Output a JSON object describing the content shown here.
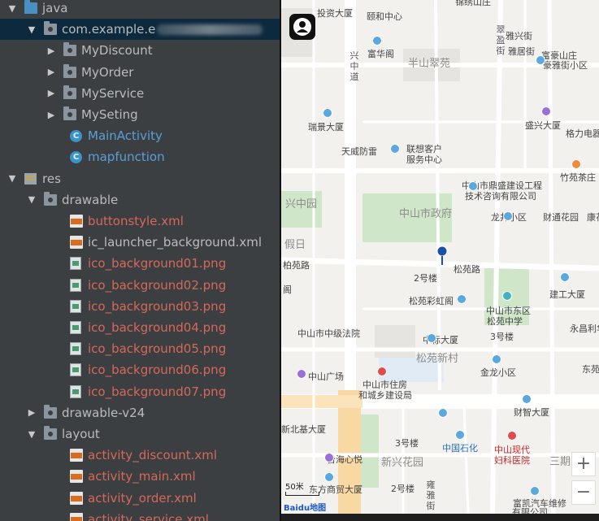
{
  "tree": {
    "items": [
      {
        "label": "java",
        "arrow": "▼",
        "icon": "folder-java",
        "indent": 0,
        "style": "plain"
      },
      {
        "label": "com.example.e",
        "arrow": "▼",
        "icon": "folder-package",
        "indent": 1,
        "style": "plain",
        "selected": true,
        "blurred_suffix": true
      },
      {
        "label": "MyDiscount",
        "arrow": "▶",
        "icon": "folder-package",
        "indent": 2,
        "style": "plain"
      },
      {
        "label": "MyOrder",
        "arrow": "▶",
        "icon": "folder-package",
        "indent": 2,
        "style": "plain"
      },
      {
        "label": "MyService",
        "arrow": "▶",
        "icon": "folder-package",
        "indent": 2,
        "style": "plain"
      },
      {
        "label": "MySeting",
        "arrow": "▶",
        "icon": "folder-package",
        "indent": 2,
        "style": "plain"
      },
      {
        "label": "MainActivity",
        "arrow": "",
        "icon": "class",
        "indent": 3,
        "style": "blue"
      },
      {
        "label": "mapfunction",
        "arrow": "",
        "icon": "class",
        "indent": 3,
        "style": "blue"
      },
      {
        "label": "res",
        "arrow": "▼",
        "icon": "res",
        "indent": 0,
        "style": "plain"
      },
      {
        "label": "drawable",
        "arrow": "▼",
        "icon": "folder-package",
        "indent": 1,
        "style": "plain"
      },
      {
        "label": "buttonstyle.xml",
        "arrow": "",
        "icon": "xml",
        "indent": 3,
        "style": "red"
      },
      {
        "label": "ic_launcher_background.xml",
        "arrow": "",
        "icon": "xml",
        "indent": 3,
        "style": "plain"
      },
      {
        "label": "ico_background01.png",
        "arrow": "",
        "icon": "png",
        "indent": 3,
        "style": "red"
      },
      {
        "label": "ico_background02.png",
        "arrow": "",
        "icon": "png",
        "indent": 3,
        "style": "red"
      },
      {
        "label": "ico_background03.png",
        "arrow": "",
        "icon": "png",
        "indent": 3,
        "style": "red"
      },
      {
        "label": "ico_background04.png",
        "arrow": "",
        "icon": "png",
        "indent": 3,
        "style": "red"
      },
      {
        "label": "ico_background05.png",
        "arrow": "",
        "icon": "png",
        "indent": 3,
        "style": "red"
      },
      {
        "label": "ico_background06.png",
        "arrow": "",
        "icon": "png",
        "indent": 3,
        "style": "red"
      },
      {
        "label": "ico_background07.png",
        "arrow": "",
        "icon": "png",
        "indent": 3,
        "style": "red"
      },
      {
        "label": "drawable-v24",
        "arrow": "▶",
        "icon": "folder-package",
        "indent": 1,
        "style": "plain"
      },
      {
        "label": "layout",
        "arrow": "▼",
        "icon": "folder-package",
        "indent": 1,
        "style": "plain"
      },
      {
        "label": "activity_discount.xml",
        "arrow": "",
        "icon": "xml",
        "indent": 3,
        "style": "red"
      },
      {
        "label": "activity_main.xml",
        "arrow": "",
        "icon": "xml",
        "indent": 3,
        "style": "red"
      },
      {
        "label": "activity_order.xml",
        "arrow": "",
        "icon": "xml",
        "indent": 3,
        "style": "red"
      },
      {
        "label": "activity_service.xml",
        "arrow": "",
        "icon": "xml",
        "indent": 3,
        "style": "red"
      }
    ]
  },
  "map": {
    "zoom_in": "+",
    "zoom_out": "−",
    "scale": "50米",
    "logo": "Baidu地图",
    "labels": [
      {
        "text": "投资大厦",
        "cls": ""
      },
      {
        "text": "颐和中心",
        "cls": ""
      },
      {
        "text": "锦绣山庄",
        "cls": ""
      },
      {
        "text": "雅兴街",
        "cls": ""
      },
      {
        "text": "富华阁",
        "cls": ""
      },
      {
        "text": "半山翠苑",
        "cls": "big"
      },
      {
        "text": "雅居街",
        "cls": ""
      },
      {
        "text": "富豪山庄",
        "cls": ""
      },
      {
        "text": "豪雅街小区",
        "cls": ""
      },
      {
        "text": "瑞景大厦",
        "cls": ""
      },
      {
        "text": "盛兴大厦",
        "cls": ""
      },
      {
        "text": "格力电器",
        "cls": ""
      },
      {
        "text": "天威防雷",
        "cls": ""
      },
      {
        "text": "联想客户",
        "cls": ""
      },
      {
        "text": "服务中心",
        "cls": ""
      },
      {
        "text": "竹苑茶庄",
        "cls": ""
      },
      {
        "text": "中山市鼎盛建设工程",
        "cls": ""
      },
      {
        "text": "技术咨询有限公司",
        "cls": ""
      },
      {
        "text": "兴中园",
        "cls": "big"
      },
      {
        "text": "中山市政府",
        "cls": "big"
      },
      {
        "text": "龙井小区",
        "cls": ""
      },
      {
        "text": "财通花园",
        "cls": ""
      },
      {
        "text": "康花园",
        "cls": ""
      },
      {
        "text": "假日",
        "cls": "big"
      },
      {
        "text": "松苑路",
        "cls": ""
      },
      {
        "text": "柏苑路",
        "cls": ""
      },
      {
        "text": "2号楼",
        "cls": ""
      },
      {
        "text": "建工大厦",
        "cls": ""
      },
      {
        "text": "松苑彩虹阁",
        "cls": ""
      },
      {
        "text": "阁",
        "cls": ""
      },
      {
        "text": "中山市东区",
        "cls": ""
      },
      {
        "text": "松苑中学",
        "cls": ""
      },
      {
        "text": "中山市中级法院",
        "cls": ""
      },
      {
        "text": "中标大厦",
        "cls": ""
      },
      {
        "text": "3号楼",
        "cls": ""
      },
      {
        "text": "永昌利华",
        "cls": ""
      },
      {
        "text": "松苑新村",
        "cls": "big"
      },
      {
        "text": "中山广场",
        "cls": ""
      },
      {
        "text": "中山市住房",
        "cls": ""
      },
      {
        "text": "和城乡建设局",
        "cls": ""
      },
      {
        "text": "金龙小区",
        "cls": ""
      },
      {
        "text": "东苑路",
        "cls": ""
      },
      {
        "text": "财智大厦",
        "cls": ""
      },
      {
        "text": "新北基大厦",
        "cls": ""
      },
      {
        "text": "3号楼",
        "cls": ""
      },
      {
        "text": "中国石化",
        "cls": "blue"
      },
      {
        "text": "中山现代",
        "cls": "red"
      },
      {
        "text": "妇科医院",
        "cls": "red"
      },
      {
        "text": "三期",
        "cls": "big"
      },
      {
        "text": "台海心悦",
        "cls": ""
      },
      {
        "text": "新兴花园",
        "cls": "big"
      },
      {
        "text": "东方商贸大厦",
        "cls": ""
      },
      {
        "text": "2号楼",
        "cls": ""
      },
      {
        "text": "富凯汽车维修",
        "cls": ""
      },
      {
        "text": "有限公司",
        "cls": ""
      },
      {
        "text": "兴中道",
        "cls": "vertical"
      },
      {
        "text": "雍雅街",
        "cls": "vertical"
      },
      {
        "text": "翠盈街",
        "cls": "vertical"
      }
    ]
  }
}
